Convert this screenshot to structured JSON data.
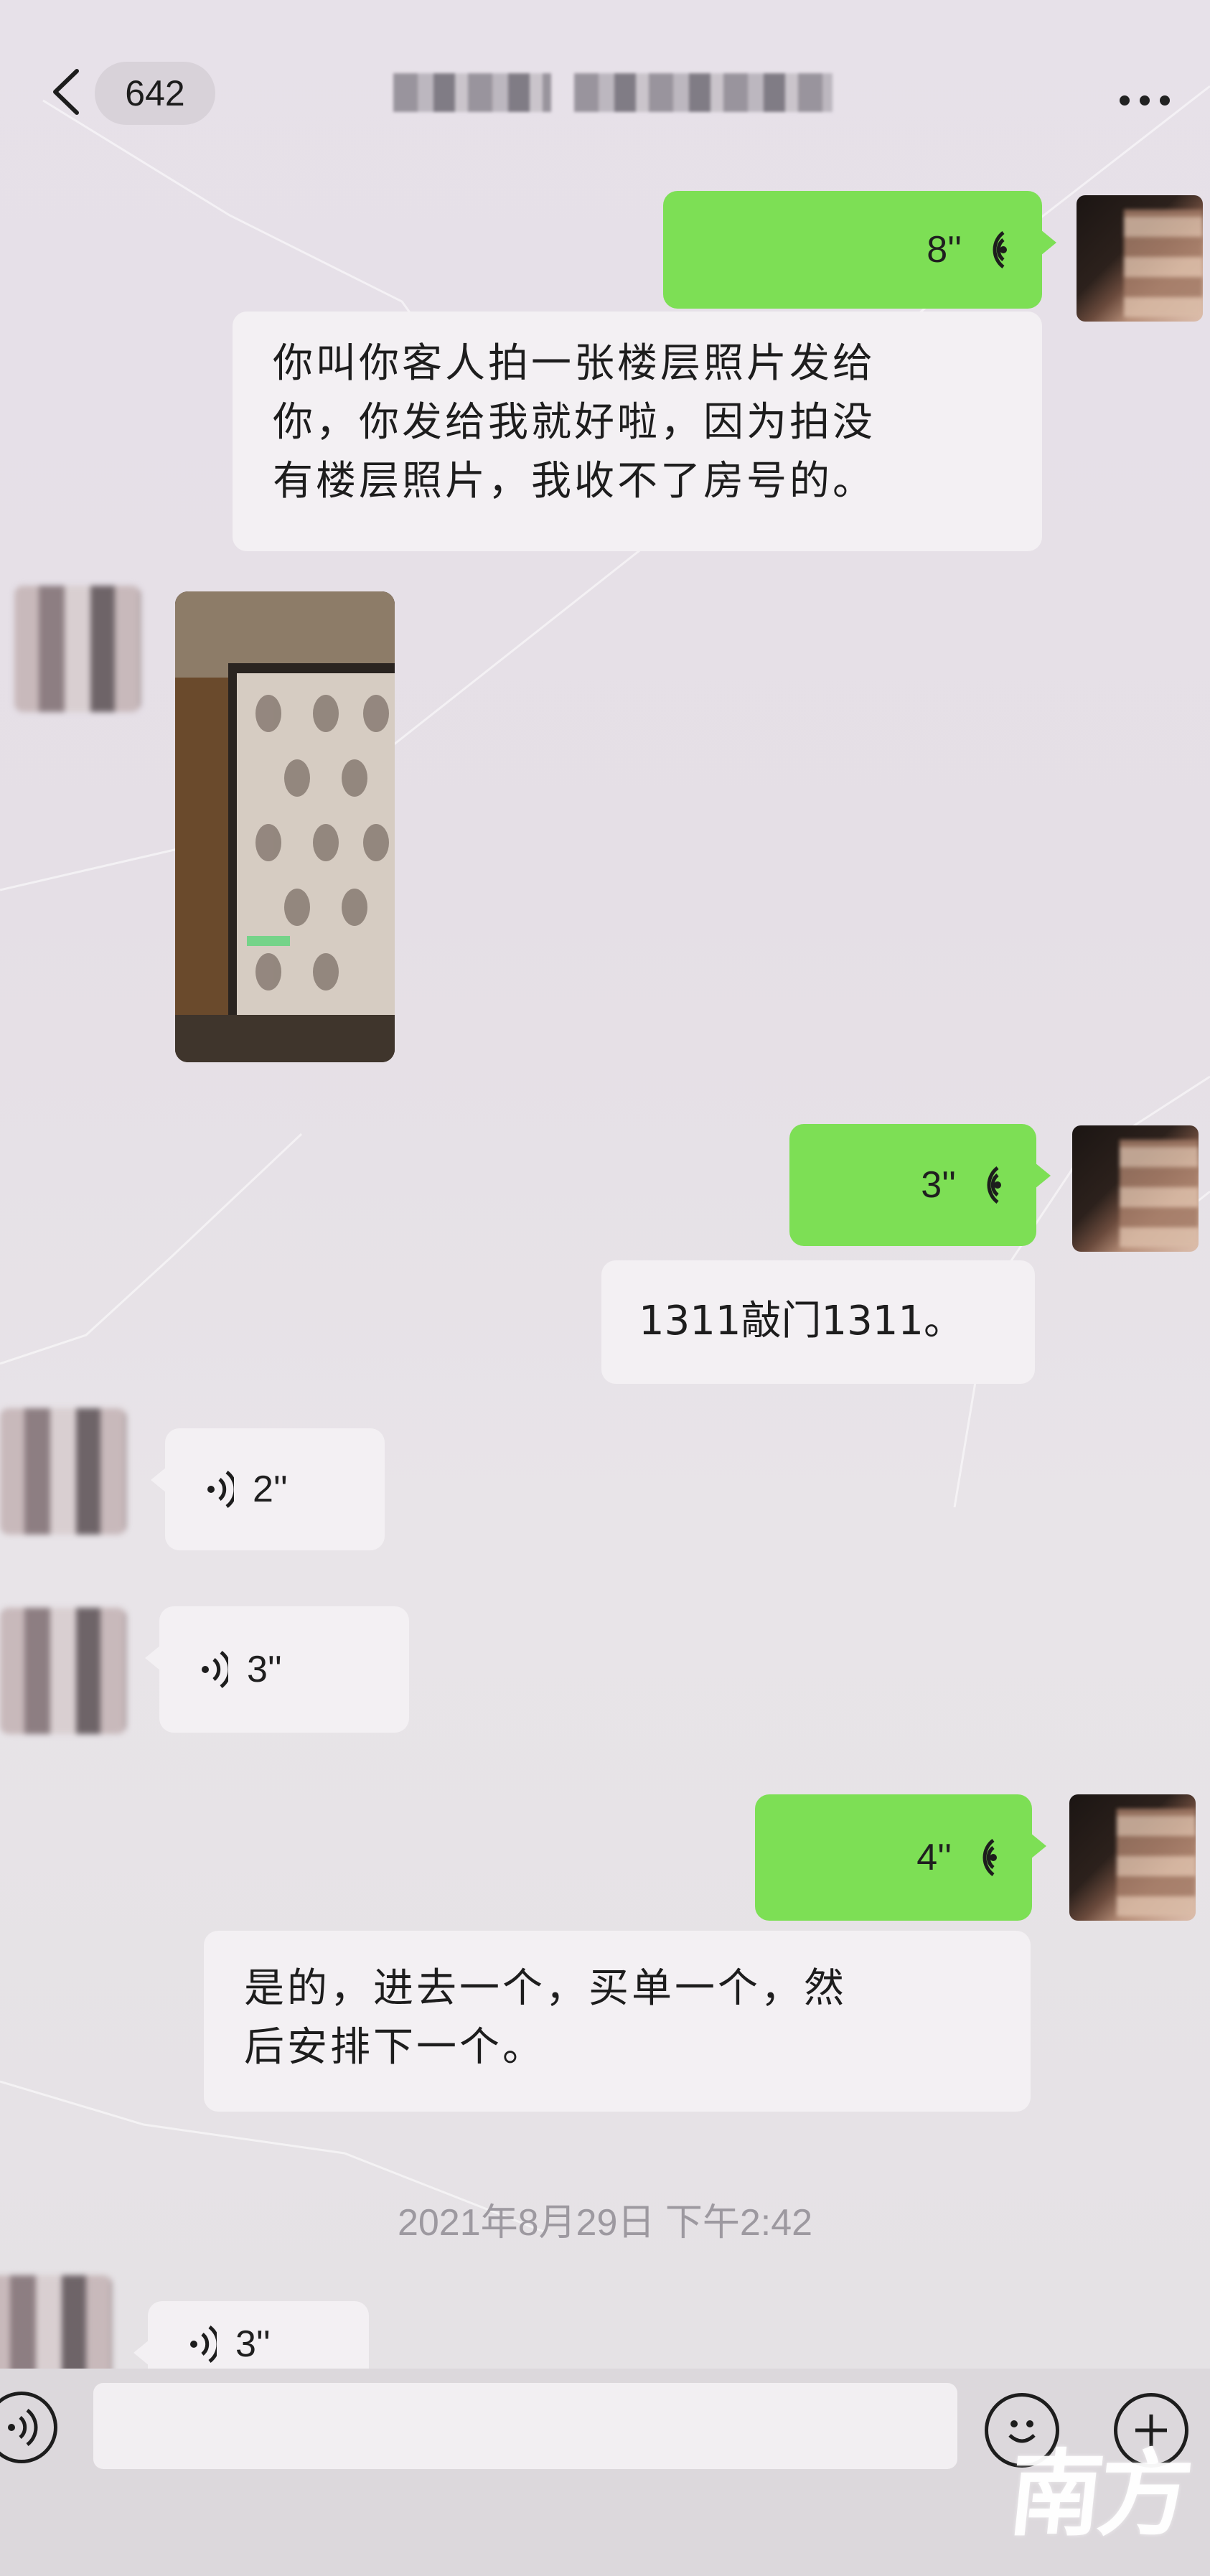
{
  "header": {
    "unread_count": "642"
  },
  "messages": [
    {
      "type": "voice",
      "side": "right",
      "duration": "8''"
    },
    {
      "type": "text",
      "side": "right",
      "lines": [
        "你叫你客人拍一张楼层照片发给",
        "你，你发给我就好啦，因为拍没",
        "有楼层照片，我收不了房号的。"
      ]
    },
    {
      "type": "image",
      "side": "left"
    },
    {
      "type": "voice",
      "side": "right",
      "duration": "3''"
    },
    {
      "type": "text",
      "side": "right",
      "lines": [
        "1311敲门1311。"
      ]
    },
    {
      "type": "voice",
      "side": "left",
      "duration": "2''"
    },
    {
      "type": "voice",
      "side": "left",
      "duration": "3''"
    },
    {
      "type": "voice",
      "side": "right",
      "duration": "4''"
    },
    {
      "type": "text",
      "side": "right",
      "lines": [
        "是的，进去一个，买单一个，然",
        "后安排下一个。"
      ]
    }
  ],
  "timestamp": "2021年8月29日 下午2:42",
  "partial_voice": {
    "duration": "3''"
  },
  "watermark": "南方+",
  "colors": {
    "outgoing_bubble": "#7ddf55",
    "incoming_bubble": "#f3f0f3",
    "timestamp": "#9d99a0"
  }
}
